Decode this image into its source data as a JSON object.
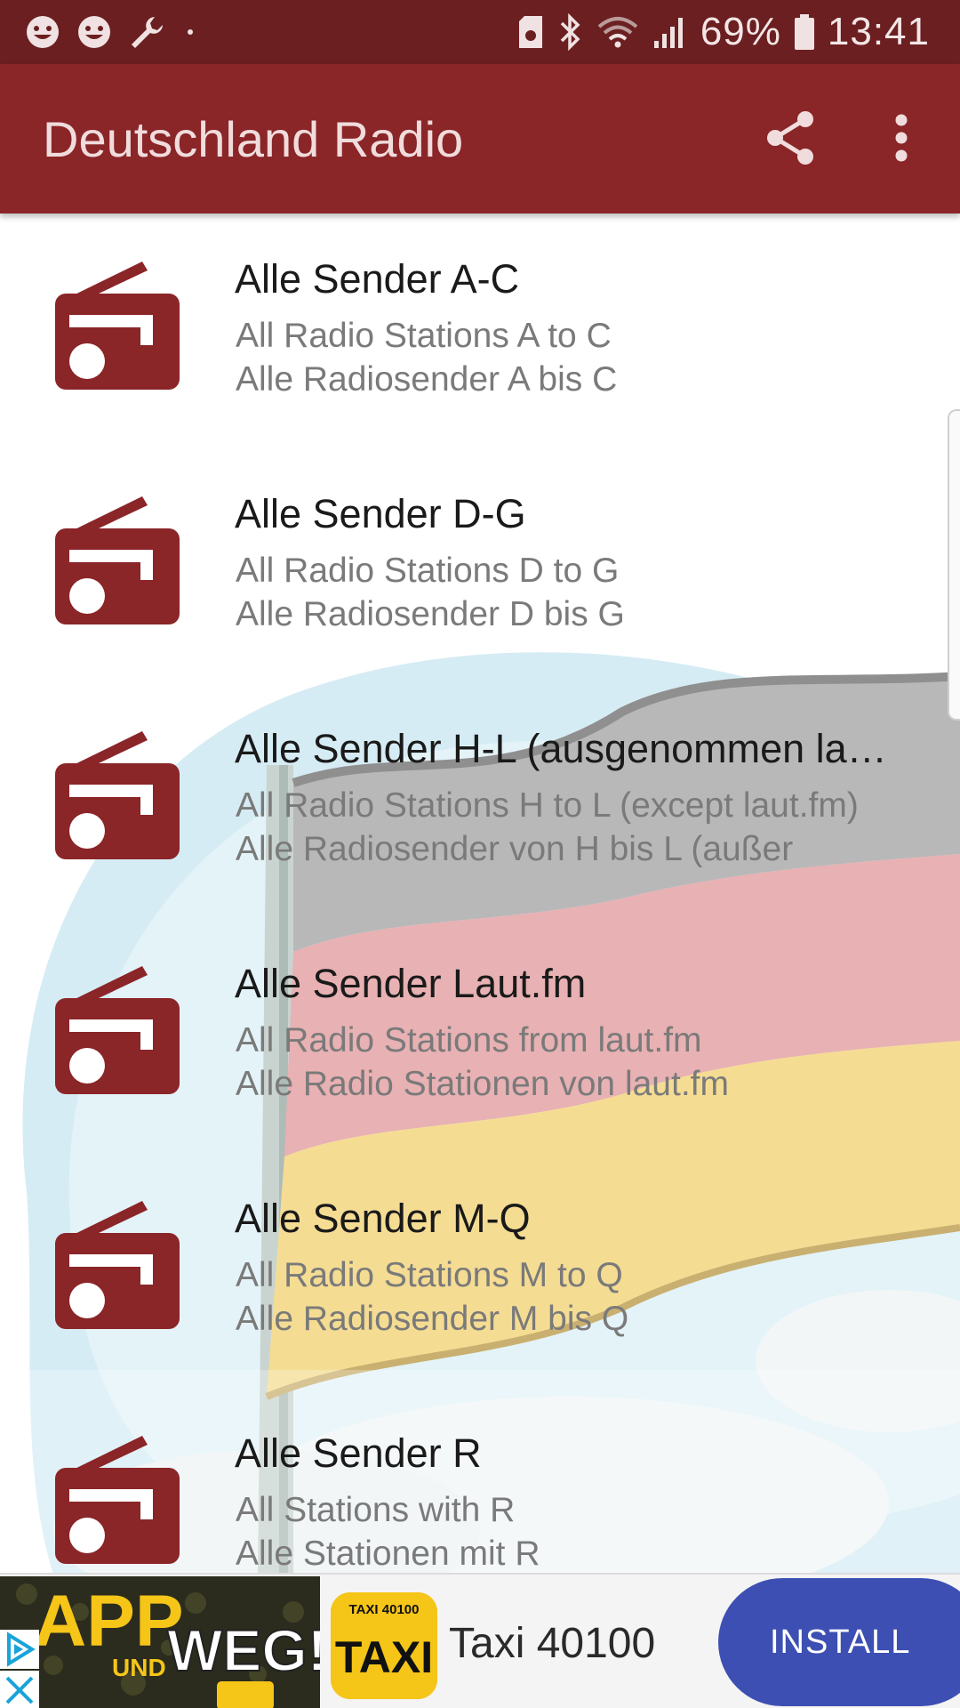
{
  "status_bar": {
    "battery": "69%",
    "time": "13:41"
  },
  "app_bar": {
    "title": "Deutschland Radio",
    "share_icon": "share-icon",
    "more_icon": "more-vert-icon"
  },
  "list": {
    "items": [
      {
        "title": "Alle Sender A-C",
        "line1": "All Radio Stations A to C",
        "line2": "Alle Radiosender A bis C",
        "icon": "radio-icon"
      },
      {
        "title": "Alle Sender D-G",
        "line1": "All Radio Stations D to G",
        "line2": "Alle Radiosender D bis G",
        "icon": "radio-icon"
      },
      {
        "title": "Alle Sender H-L (ausgenommen la…",
        "line1": "All Radio Stations H to L (except laut.fm)",
        "line2": "Alle Radiosender von H bis L (außer",
        "icon": "radio-icon"
      },
      {
        "title": "Alle Sender Laut.fm",
        "line1": "All Radio Stations from laut.fm",
        "line2": "Alle Radio Stationen von laut.fm",
        "icon": "radio-icon"
      },
      {
        "title": "Alle Sender M-Q",
        "line1": "All Radio Stations M to Q",
        "line2": "Alle Radiosender M bis Q",
        "icon": "radio-icon"
      },
      {
        "title": "Alle Sender R",
        "line1": "All Stations with R",
        "line2": "Alle Stationen mit R",
        "icon": "radio-icon"
      }
    ]
  },
  "ad": {
    "image_text_1": "APP",
    "image_text_2": "UND",
    "image_text_3": "WEG!",
    "app_name": "Taxi 40100",
    "install_label": "INSTALL",
    "icon_label": "TAXI 40100",
    "icon_word": "TAXI"
  },
  "colors": {
    "status_bar": "#6b1f21",
    "app_bar": "#8a2528",
    "icon": "#8a2528",
    "install": "#3e4fb3"
  }
}
